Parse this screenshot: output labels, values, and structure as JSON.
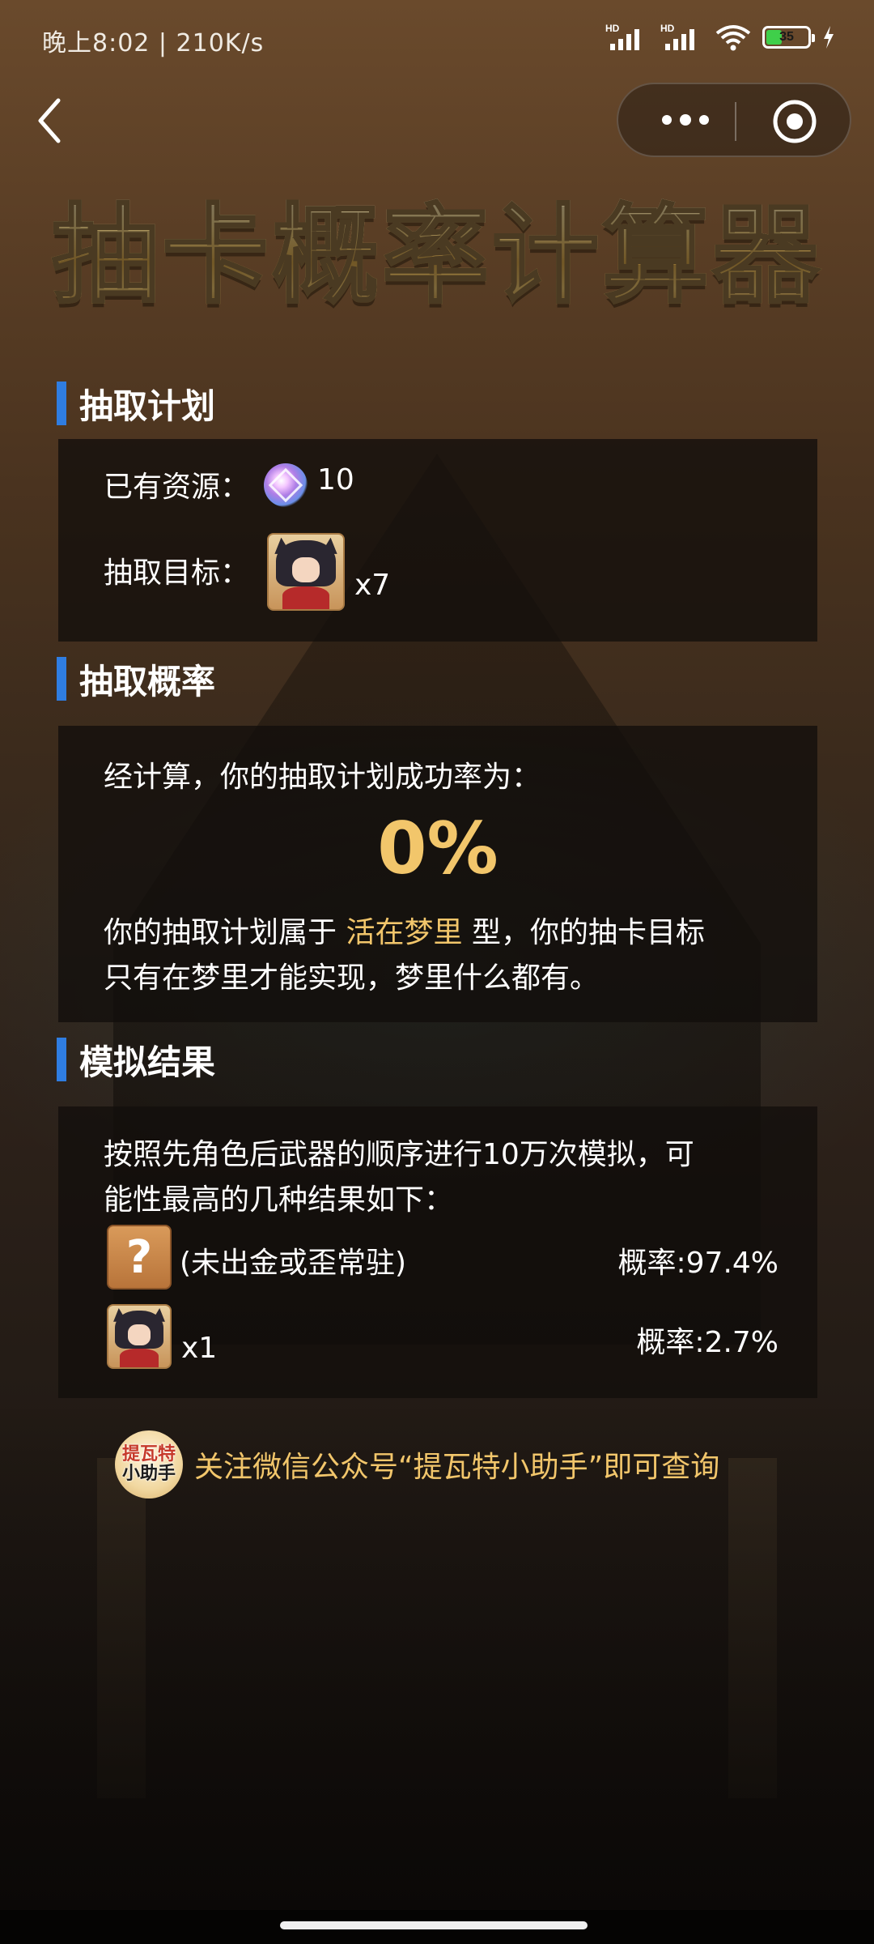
{
  "status_bar": {
    "time": "晚上8:02 | 210K/s",
    "network_1": "HD",
    "network_2": "HD",
    "battery": "35"
  },
  "header": {
    "title": "抽卡概率计算器"
  },
  "plan_section": {
    "heading": "抽取计划",
    "resources_label": "已有资源：",
    "resources_value": "10",
    "target_label": "抽取目标：",
    "target_count": "x7"
  },
  "probability_section": {
    "heading": "抽取概率",
    "intro": "经计算，你的抽取计划成功率为：",
    "value": "0%",
    "desc_prefix": "你的抽取计划属于",
    "desc_type": "活在梦里",
    "desc_suffix_line1": "型，你的抽卡目标",
    "desc_line2": "只有在梦里才能实现，梦里什么都有。"
  },
  "simulation_section": {
    "heading": "模拟结果",
    "intro_line1": "按照先角色后武器的顺序进行10万次模拟，可",
    "intro_line2": "能性最高的几种结果如下：",
    "results": [
      {
        "icon": "mystery-icon",
        "icon_text": "?",
        "label": "(未出金或歪常驻)",
        "prob": "概率:97.4%"
      },
      {
        "icon": "character-portrait",
        "label": "x1",
        "prob": "概率:2.7%"
      }
    ]
  },
  "footer": {
    "avatar_text_1": "提瓦特",
    "avatar_text_2": "小助手",
    "note": "关注微信公众号“提瓦特小助手”即可查询"
  },
  "colors": {
    "accent_blue": "#2f7de1",
    "highlight_gold": "#f2c66b",
    "card_bg": "rgba(18,14,12,0.78)"
  }
}
